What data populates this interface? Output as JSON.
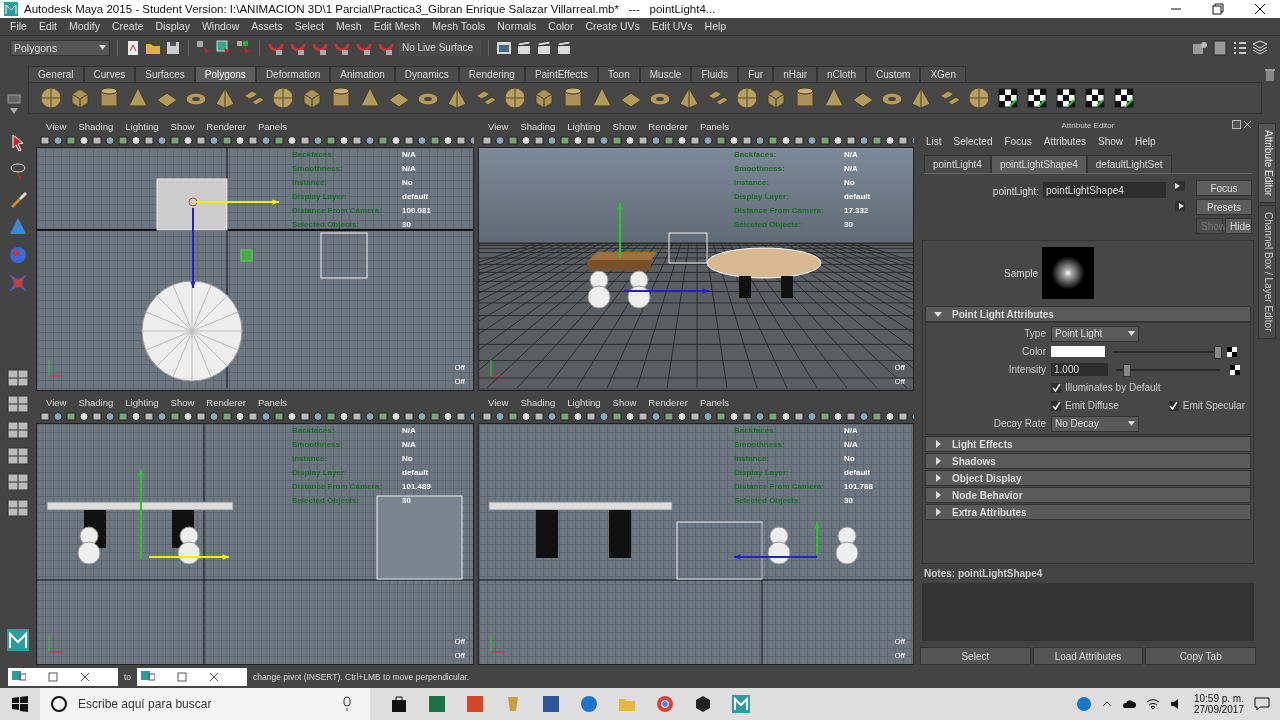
{
  "window": {
    "title": "Autodesk Maya 2015 - Student Version: I:\\ANIMACION 3D\\1 Parcial\\Practica3_Gibran Enrique Salazar Villarreal.mb*   ---   pointLight4..."
  },
  "menu_bar": [
    "File",
    "Edit",
    "Modify",
    "Create",
    "Display",
    "Window",
    "Assets",
    "Select",
    "Mesh",
    "Edit Mesh",
    "Mesh Tools",
    "Normals",
    "Color",
    "Create UVs",
    "Edit UVs",
    "Help"
  ],
  "toolbar": {
    "menu_set": "Polygons",
    "live_surface": "No Live Surface"
  },
  "shelf": {
    "tabs": [
      {
        "label": "General",
        "selected": false
      },
      {
        "label": "Curves",
        "selected": false
      },
      {
        "label": "Surfaces",
        "selected": false
      },
      {
        "label": "Polygons",
        "selected": true
      },
      {
        "label": "Deformation",
        "selected": false
      },
      {
        "label": "Animation",
        "selected": false
      },
      {
        "label": "Dynamics",
        "selected": false
      },
      {
        "label": "Rendering",
        "selected": false
      },
      {
        "label": "PaintEffects",
        "selected": false
      },
      {
        "label": "Toon",
        "selected": false
      },
      {
        "label": "Muscle",
        "selected": false
      },
      {
        "label": "Fluids",
        "selected": false
      },
      {
        "label": "Fur",
        "selected": false
      },
      {
        "label": "nHair",
        "selected": false
      },
      {
        "label": "nCloth",
        "selected": false
      },
      {
        "label": "Custom",
        "selected": false
      },
      {
        "label": "XGen",
        "selected": false
      }
    ]
  },
  "viewports": [
    {
      "kind": "top",
      "menu": [
        "View",
        "Shading",
        "Lighting",
        "Show",
        "Renderer",
        "Panels"
      ],
      "hud": [
        {
          "label": "Backfaces:",
          "value": "N/A"
        },
        {
          "label": "Smoothness:",
          "value": "N/A"
        },
        {
          "label": "Instance:",
          "value": "No"
        },
        {
          "label": "Display Layer:",
          "value": "default"
        },
        {
          "label": "Distance From Camera:",
          "value": "100.081"
        },
        {
          "label": "Selected Objects:",
          "value": "30"
        }
      ],
      "flags": [
        "Off",
        "Off"
      ]
    },
    {
      "kind": "persp",
      "menu": [
        "View",
        "Shading",
        "Lighting",
        "Show",
        "Renderer",
        "Panels"
      ],
      "hud": [
        {
          "label": "Backfaces:",
          "value": "N/A"
        },
        {
          "label": "Smoothness:",
          "value": "N/A"
        },
        {
          "label": "Instance:",
          "value": "No"
        },
        {
          "label": "Display Layer:",
          "value": "default"
        },
        {
          "label": "Distance From Camera:",
          "value": "17.332"
        },
        {
          "label": "Selected Objects:",
          "value": "30"
        }
      ],
      "flags": [
        "Off",
        "Off"
      ]
    },
    {
      "kind": "front",
      "menu": [
        "View",
        "Shading",
        "Lighting",
        "Show",
        "Renderer",
        "Panels"
      ],
      "hud": [
        {
          "label": "Backfaces:",
          "value": "N/A"
        },
        {
          "label": "Smoothness:",
          "value": "N/A"
        },
        {
          "label": "Instance:",
          "value": "No"
        },
        {
          "label": "Display Layer:",
          "value": "default"
        },
        {
          "label": "Distance From Camera:",
          "value": "101.489"
        },
        {
          "label": "Selected Objects:",
          "value": "30"
        }
      ],
      "flags": [
        "Off",
        "Off"
      ]
    },
    {
      "kind": "side",
      "menu": [
        "View",
        "Shading",
        "Lighting",
        "Show",
        "Renderer",
        "Panels"
      ],
      "hud": [
        {
          "label": "Backfaces:",
          "value": "N/A"
        },
        {
          "label": "Smoothness:",
          "value": "N/A"
        },
        {
          "label": "Instance:",
          "value": "No"
        },
        {
          "label": "Display Layer:",
          "value": "default"
        },
        {
          "label": "Distance From Camera:",
          "value": "101.788"
        },
        {
          "label": "Selected Objects:",
          "value": "30"
        }
      ],
      "flags": [
        "Off",
        "Off"
      ]
    }
  ],
  "attribute_editor": {
    "title": "Attribute Editor",
    "menu": [
      "List",
      "Selected",
      "Focus",
      "Attributes",
      "Show",
      "Help"
    ],
    "tabs": [
      {
        "label": "pointLight4",
        "selected": false
      },
      {
        "label": "pointLightShape4",
        "selected": true
      },
      {
        "label": "defaultLightSet",
        "selected": false
      }
    ],
    "node_label": "pointLight:",
    "node_value": "pointLightShape4",
    "buttons": [
      "Focus",
      "Presets"
    ],
    "show_hide": [
      {
        "label": "Show",
        "disabled": true
      },
      {
        "label": "Hide",
        "disabled": false
      }
    ],
    "sample_label": "Sample",
    "section": {
      "title": "Point Light Attributes",
      "expanded": true
    },
    "type": {
      "label": "Type",
      "value": "Point Light"
    },
    "color": {
      "label": "Color",
      "level": 1.0
    },
    "intensity": {
      "label": "Intensity",
      "value": "1.000",
      "level": 0.1
    },
    "checks": [
      {
        "label": "Illuminates by Default",
        "checked": true
      },
      {
        "label": "Emit Diffuse",
        "checked": true
      },
      {
        "label": "Emit Specular",
        "checked": true
      }
    ],
    "decay": {
      "label": "Decay Rate",
      "value": "No Decay"
    },
    "sections": [
      {
        "title": "Light Effects",
        "expanded": false
      },
      {
        "title": "Shadows",
        "expanded": false
      },
      {
        "title": "Object Display",
        "expanded": false
      },
      {
        "title": "Node Behavior",
        "expanded": false
      },
      {
        "title": "Extra Attributes",
        "expanded": false
      }
    ],
    "notes_label": "Notes:  pointLightShape4",
    "bottom_buttons": [
      "Select",
      "Load Attributes",
      "Copy Tab"
    ]
  },
  "side_tabs": [
    {
      "label": "Attribute Editor",
      "selected": true
    },
    {
      "label": "Channel Box / Layer Editor",
      "selected": false
    }
  ],
  "status_line": {
    "prefix": "to",
    "message": "change pivot (INSERT).  Ctrl+LMB to move perpendicular."
  },
  "taskbar": {
    "search_placeholder": "Escribe aquí para buscar",
    "time": "10:59 p. m.",
    "date": "27/09/2017"
  }
}
